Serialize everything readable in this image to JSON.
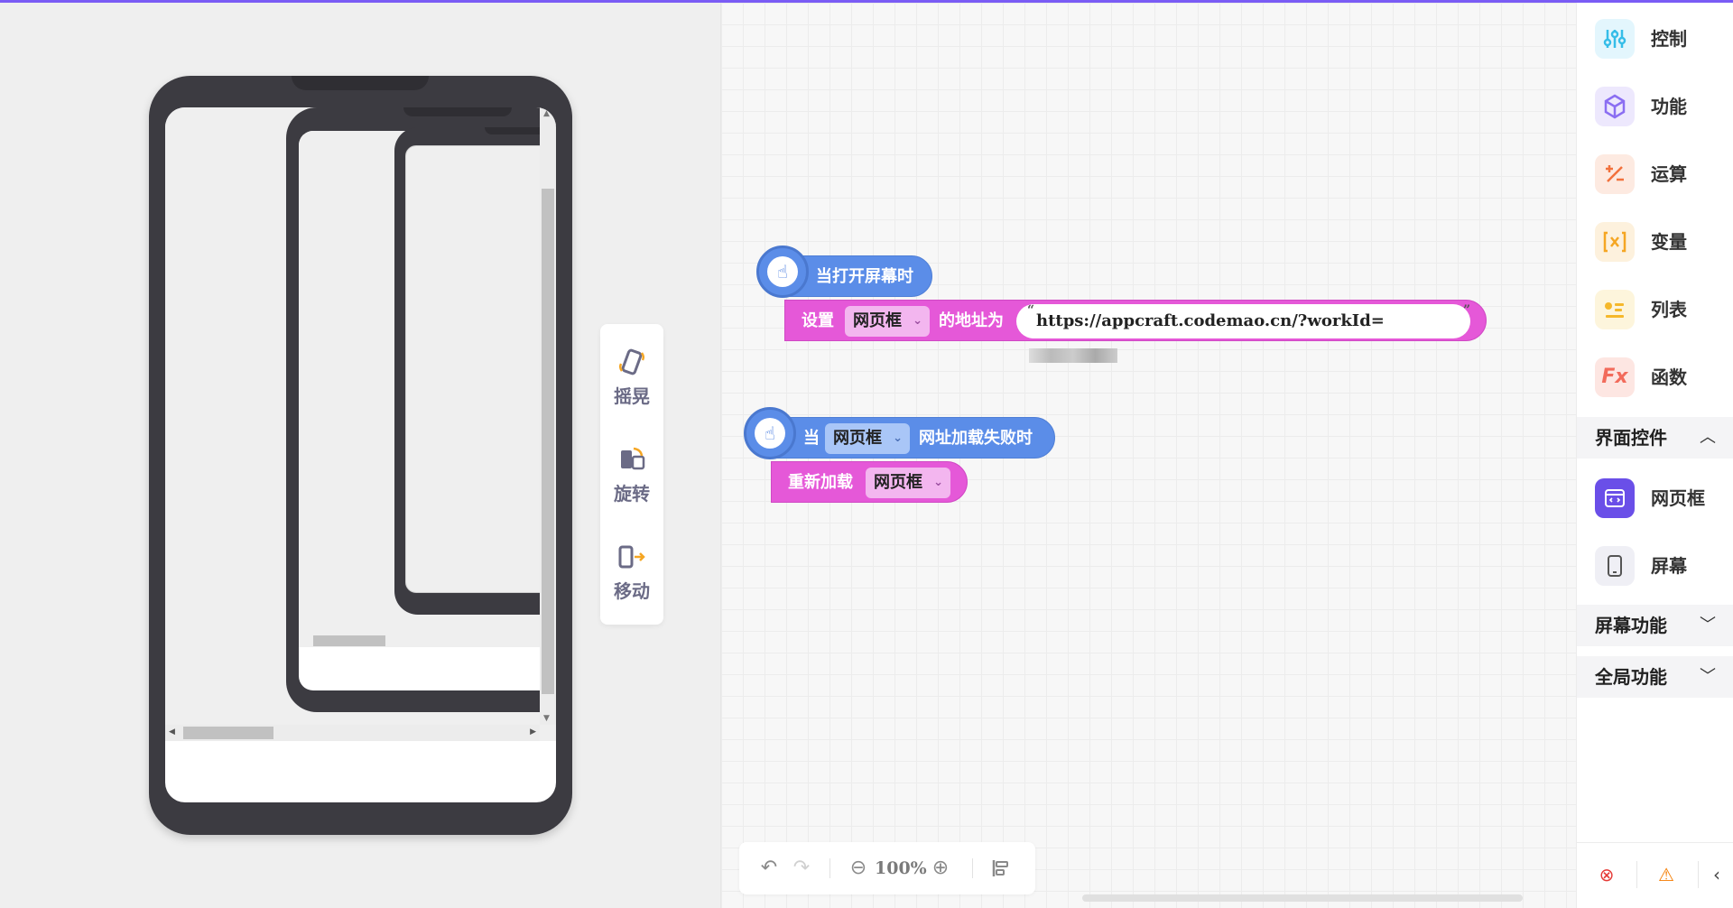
{
  "preview": {
    "tools": [
      {
        "label": "摇晃",
        "icon": "shake-phone-icon"
      },
      {
        "label": "旋转",
        "icon": "rotate-phone-icon"
      },
      {
        "label": "移动",
        "icon": "move-phone-icon"
      }
    ]
  },
  "workspace": {
    "block1": {
      "hat_label": "当打开屏幕时",
      "set_label": "设置",
      "dropdown": "网页框",
      "address_label": "的地址为",
      "url": "https://appcraft.codemao.cn/?workId="
    },
    "block2": {
      "when_label": "当",
      "dropdown": "网页框",
      "event_label": "网址加载失败时",
      "reload_label": "重新加载",
      "reload_dropdown": "网页框"
    },
    "zoom": {
      "percent": "100%"
    }
  },
  "panel": {
    "categories": [
      {
        "label": "控制",
        "icon": "sliders-icon",
        "color": "#35bde8",
        "bg": "#e3f6fd"
      },
      {
        "label": "功能",
        "icon": "cube-icon",
        "color": "#8b6ef2",
        "bg": "#ede8fd"
      },
      {
        "label": "运算",
        "icon": "plus-minus-icon",
        "color": "#f2713c",
        "bg": "#fdeae1"
      },
      {
        "label": "变量",
        "icon": "variable-icon",
        "color": "#f5a623",
        "bg": "#fdf1dd"
      },
      {
        "label": "列表",
        "icon": "list-icon",
        "color": "#f5b82b",
        "bg": "#fdf5dc"
      },
      {
        "label": "函数",
        "icon": "function-icon",
        "color": "#f26b5b",
        "bg": "#fde6e2"
      }
    ],
    "sections": {
      "ui_controls": "界面控件",
      "screen_functions": "屏幕功能",
      "global_functions": "全局功能"
    },
    "controls": [
      {
        "label": "网页框",
        "icon": "webview-icon"
      },
      {
        "label": "屏幕",
        "icon": "phone-screen-icon"
      }
    ],
    "fx_text": "Fx"
  }
}
